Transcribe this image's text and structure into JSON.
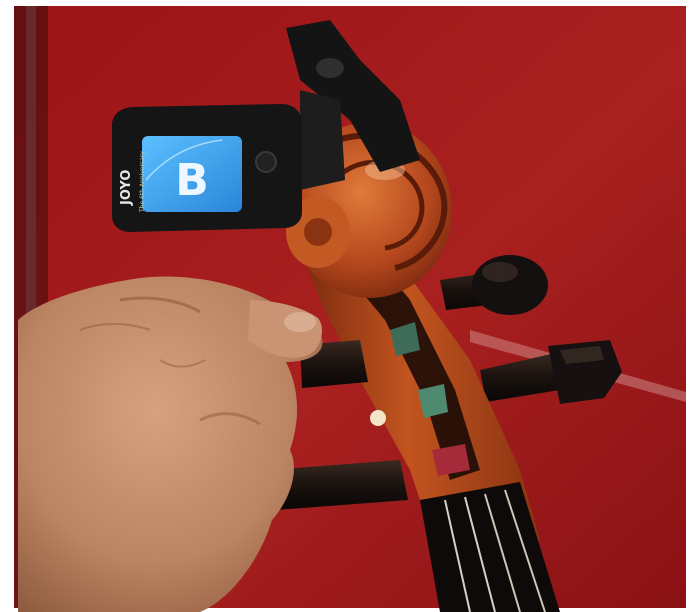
{
  "tuner": {
    "brand": "JOYO",
    "tagline": "The 6th Anniversary",
    "note": "B"
  },
  "colors": {
    "backdrop": "#a1191d",
    "wood": "#b4461d",
    "tuner_body": "#151515",
    "tuner_screen": "#3aa8f0",
    "skin": "#c48d6a"
  }
}
